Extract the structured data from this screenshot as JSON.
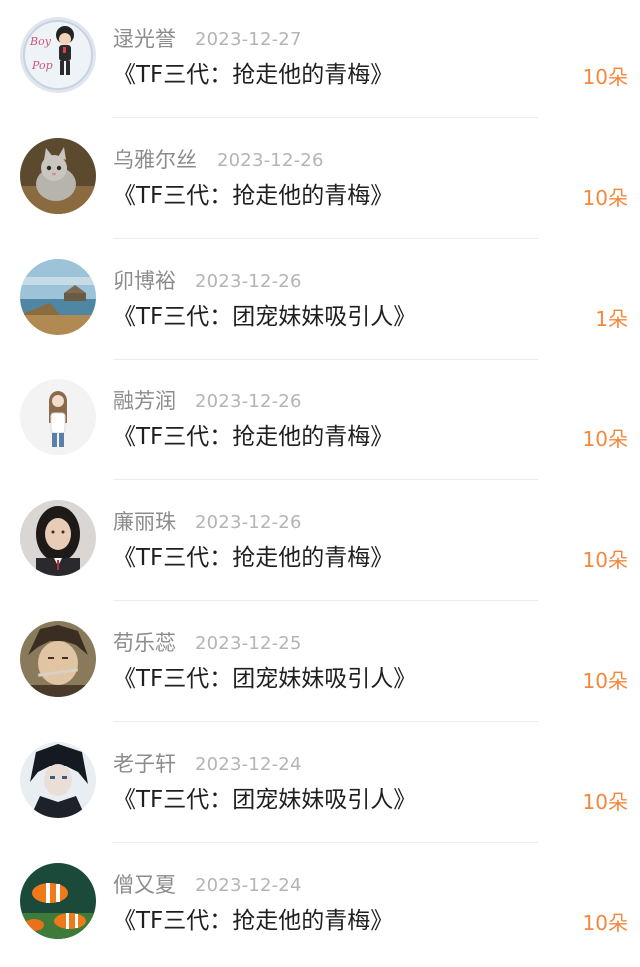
{
  "gift_list": [
    {
      "name": "逯光誉",
      "date": "2023-12-27",
      "title": "《TF三代：抢走他的青梅》",
      "count": "10朵",
      "avatar": "avatar-boy-cartoon-icon"
    },
    {
      "name": "乌雅尔丝",
      "date": "2023-12-26",
      "title": "《TF三代：抢走他的青梅》",
      "count": "10朵",
      "avatar": "avatar-kitten-icon"
    },
    {
      "name": "卯博裕",
      "date": "2023-12-26",
      "title": "《TF三代：团宠妹妹吸引人》",
      "count": "1朵",
      "avatar": "avatar-seascape-icon"
    },
    {
      "name": "融芳润",
      "date": "2023-12-26",
      "title": "《TF三代：抢走他的青梅》",
      "count": "10朵",
      "avatar": "avatar-illustrated-girl-icon"
    },
    {
      "name": "廉丽珠",
      "date": "2023-12-26",
      "title": "《TF三代：抢走他的青梅》",
      "count": "10朵",
      "avatar": "avatar-girl-photo-icon"
    },
    {
      "name": "苟乐蕊",
      "date": "2023-12-25",
      "title": "《TF三代：团宠妹妹吸引人》",
      "count": "10朵",
      "avatar": "avatar-anime-boy-icon"
    },
    {
      "name": "老子轩",
      "date": "2023-12-24",
      "title": "《TF三代：团宠妹妹吸引人》",
      "count": "10朵",
      "avatar": "avatar-dark-anime-icon"
    },
    {
      "name": "僧又夏",
      "date": "2023-12-24",
      "title": "《TF三代：抢走他的青梅》",
      "count": "10朵",
      "avatar": "avatar-clownfish-icon"
    }
  ],
  "colors": {
    "name": "#8c8c8c",
    "date": "#b4b4b4",
    "title": "#1f1f1f",
    "count": "#f5873c",
    "divider": "#ececec"
  }
}
